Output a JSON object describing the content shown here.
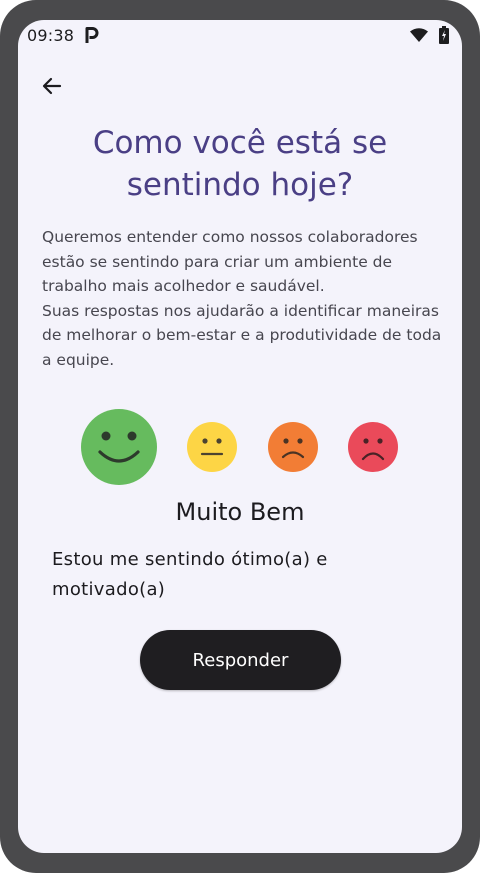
{
  "status_bar": {
    "time": "09:38",
    "app_icon": "parking-p-icon",
    "wifi_icon": "wifi-icon",
    "battery_icon": "battery-charging-icon"
  },
  "header": {
    "back_icon": "arrow-left-icon"
  },
  "title": "Como você está se sentindo hoje?",
  "description": "Queremos entender como nossos colaboradores estão se sentindo para criar um ambiente de trabalho mais acolhedor e saudável.\nSuas respostas nos ajudarão a identificar maneiras de melhorar o bem-estar e a produtividade de toda a equipe.",
  "moods": [
    {
      "id": "muito-bem",
      "icon": "happy-face-icon",
      "color": "#66bb5e",
      "selected": true
    },
    {
      "id": "neutro",
      "icon": "neutral-face-icon",
      "color": "#fdd545",
      "selected": false
    },
    {
      "id": "mal",
      "icon": "sad-face-icon",
      "color": "#f27d35",
      "selected": false
    },
    {
      "id": "muito-mal",
      "icon": "very-sad-face-icon",
      "color": "#ea4a5a",
      "selected": false
    }
  ],
  "selected_mood": {
    "label": "Muito Bem",
    "description": "Estou me sentindo ótimo(a) e motivado(a)"
  },
  "submit_label": "Responder",
  "colors": {
    "title": "#4a3f85",
    "screen_bg": "#f4f3fb",
    "button_bg": "#1f1e21"
  }
}
